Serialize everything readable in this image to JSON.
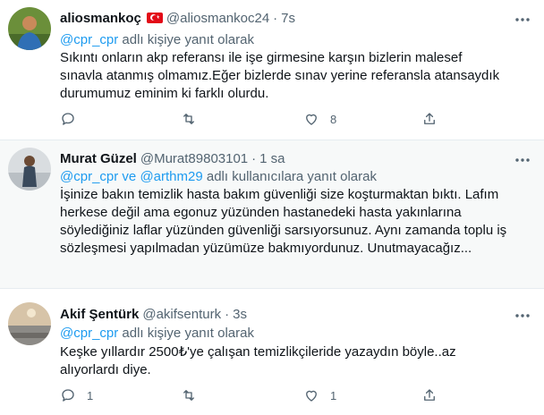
{
  "tweets": [
    {
      "name": "aliosmankoç",
      "handle": "@aliosmankoc24",
      "sep": "·",
      "time": "7s",
      "reply_prefix": "",
      "reply_user1": "@cpr_cpr",
      "reply_and": "",
      "reply_user2": "",
      "reply_suffix": " adlı kişiye yanıt olarak",
      "text": "Sıkıntı onların akp referansı ile işe girmesine karşın bizlerin malesef sınavla atanmış olmamız.Eğer bizlerde sınav yerine referansla atansaydık durumumuz eminim ki farklı olurdu.",
      "reply_count": "",
      "retweet_count": "",
      "like_count": "8"
    },
    {
      "name": "Murat Güzel",
      "handle": "@Murat89803101",
      "sep": "·",
      "time": "1 sa",
      "reply_user1": "@cpr_cpr",
      "reply_and": " ve ",
      "reply_user2": "@arthm29",
      "reply_suffix": " adlı kullanıcılara yanıt olarak",
      "text": "İşinize bakın temizlik hasta bakım güvenliği size koşturmaktan bıktı. Lafım herkese değil ama egonuz yüzünden hastanedeki hasta yakınlarına söylediğiniz laflar yüzünden güvenliği sarsıyorsunuz. Aynı zamanda toplu iş sözleşmesi yapılmadan yüzümüze bakmıyordunuz. Unutmayacağız...",
      "reply_count": "",
      "retweet_count": "",
      "like_count": ""
    },
    {
      "name": "Akif Şentürk",
      "handle": "@akifsenturk",
      "sep": "·",
      "time": "3s",
      "reply_user1": "@cpr_cpr",
      "reply_and": "",
      "reply_user2": "",
      "reply_suffix": " adlı kişiye yanıt olarak",
      "text": "Keşke yıllardır 2500₺'ye çalışan temizlikçileride yazaydın böyle..az alıyorlardı diye.",
      "reply_count": "1",
      "retweet_count": "",
      "like_count": "1"
    }
  ],
  "icons": {
    "more": "more-dots-icon",
    "reply": "reply-bubble-icon",
    "retweet": "retweet-icon",
    "like": "heart-icon",
    "share": "share-icon",
    "flag": "turkey-flag-icon"
  },
  "colors": {
    "link": "#1d9bf0",
    "muted": "#536471",
    "text": "#0f1419",
    "hover_bg": "#f7f9f9",
    "divider": "#e6ecf0"
  }
}
